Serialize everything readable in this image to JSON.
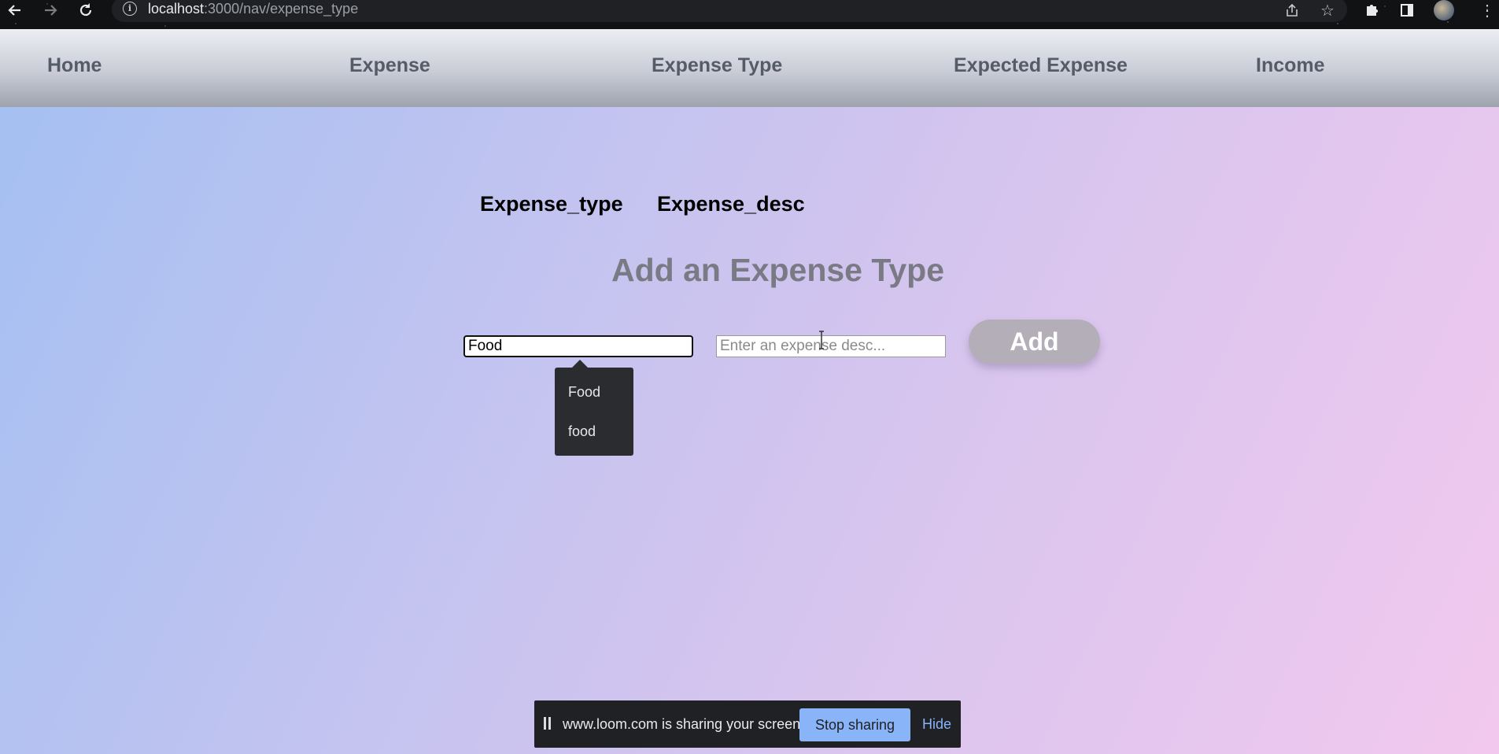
{
  "browser": {
    "url_host": "localhost",
    "url_path": ":3000/nav/expense_type"
  },
  "nav": {
    "items": [
      {
        "label": "Home"
      },
      {
        "label": "Expense"
      },
      {
        "label": "Expense Type"
      },
      {
        "label": "Expected Expense"
      },
      {
        "label": "Income"
      }
    ]
  },
  "table": {
    "headers": [
      "Expense_type",
      "Expense_desc"
    ]
  },
  "form": {
    "title": "Add an Expense Type",
    "type_input": {
      "value": "Food"
    },
    "desc_input": {
      "value": "",
      "placeholder": "Enter an expense desc..."
    },
    "add_label": "Add"
  },
  "autocomplete": {
    "options": [
      "Food",
      "food"
    ]
  },
  "share_banner": {
    "message": "www.loom.com is sharing your screen.",
    "stop_label": "Stop sharing",
    "hide_label": "Hide"
  },
  "colors": {
    "nav_text": "#555b68",
    "title_text": "#7a7a84",
    "add_button": "#b3aeb8",
    "stop_button": "#8ab4f8"
  }
}
